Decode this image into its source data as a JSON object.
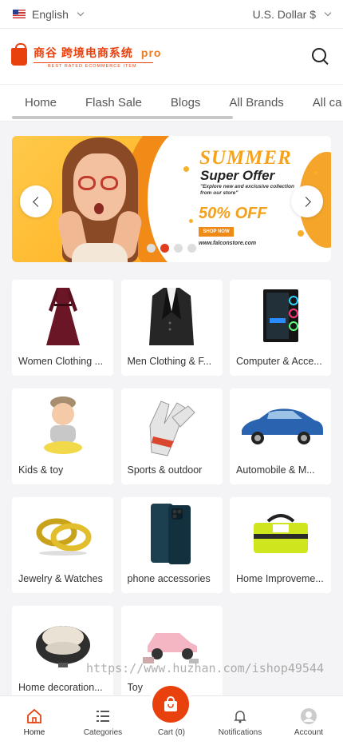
{
  "topbar": {
    "language": "English",
    "currency": "U.S. Dollar $"
  },
  "logo": {
    "main": "商谷  跨境电商系统",
    "pro": "pro",
    "tagline": "BEST RATED ECOMMERCE ITEM"
  },
  "tabs": [
    "Home",
    "Flash Sale",
    "Blogs",
    "All Brands",
    "All ca"
  ],
  "banner": {
    "headline": "SUMMER",
    "subheadline": "Super Offer",
    "tagline": "\"Explore new and exclusive collection from our store\"",
    "discount": "50% OFF",
    "button": "SHOP NOW",
    "website": "www.falconstore.com",
    "slide_count": 4,
    "active_slide": 2
  },
  "categories": [
    {
      "label": "Women Clothing ...",
      "icon": "dress-image"
    },
    {
      "label": "Men Clothing & F...",
      "icon": "blazer-image"
    },
    {
      "label": "Computer & Acce...",
      "icon": "pc-case-image"
    },
    {
      "label": "Kids & toy",
      "icon": "baby-image"
    },
    {
      "label": "Sports & outdoor",
      "icon": "gloves-image"
    },
    {
      "label": "Automobile & M...",
      "icon": "car-image"
    },
    {
      "label": "Jewelry & Watches",
      "icon": "rings-image"
    },
    {
      "label": "phone accessories",
      "icon": "phone-image"
    },
    {
      "label": "Home Improveme...",
      "icon": "toolbag-image"
    },
    {
      "label": "Home decoration...",
      "icon": "chair-image"
    },
    {
      "label": "Toy",
      "icon": "toy-car-image"
    }
  ],
  "watermark": "https://www.huzhan.com/ishop49544",
  "bottom_nav": {
    "home": "Home",
    "categories": "Categories",
    "cart": "Cart (0)",
    "notifications": "Notifications",
    "account": "Account"
  },
  "colors": {
    "brand": "#e8410e",
    "banner_accent": "#f7a31a"
  }
}
